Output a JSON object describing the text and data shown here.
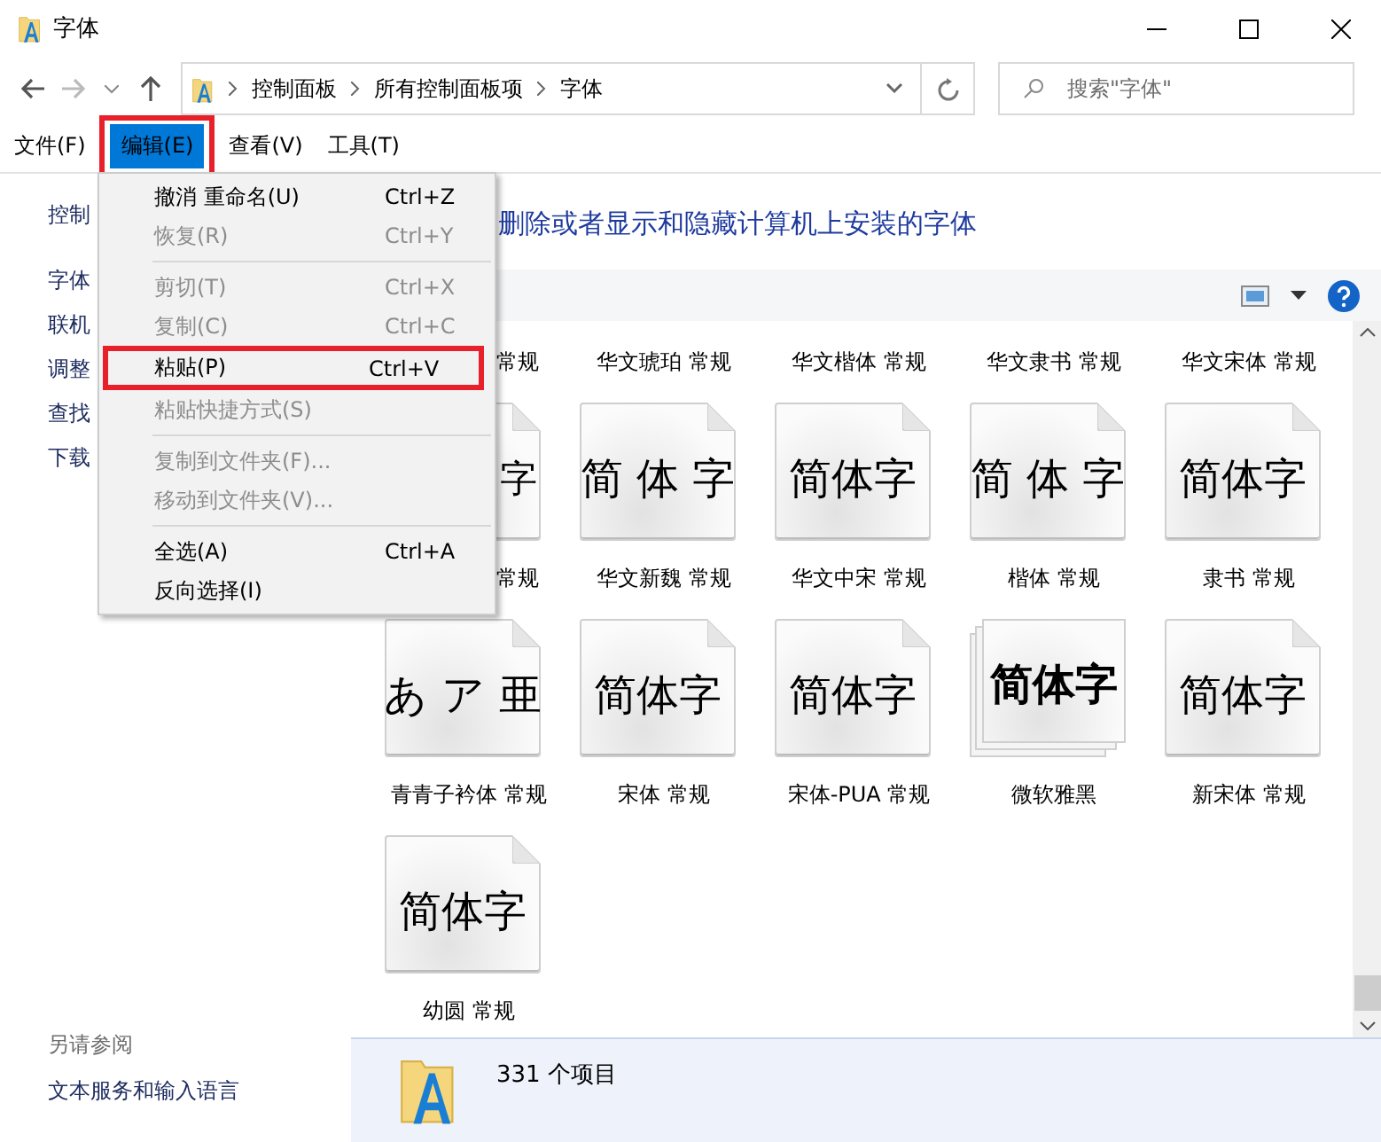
{
  "window": {
    "title": "字体"
  },
  "address_bar": {
    "crumbs": [
      "控制面板",
      "所有控制面板项",
      "字体"
    ]
  },
  "search": {
    "placeholder": "搜索\"字体\""
  },
  "menu_bar": [
    {
      "label": "文件(F)",
      "selected": false,
      "annotated": false
    },
    {
      "label": "编辑(E)",
      "selected": true,
      "annotated": true
    },
    {
      "label": "查看(V)",
      "selected": false,
      "annotated": false
    },
    {
      "label": "工具(T)",
      "selected": false,
      "annotated": false
    }
  ],
  "edit_menu": {
    "items": [
      {
        "kind": "item",
        "label": "撤消 重命名(U)",
        "shortcut": "Ctrl+Z",
        "disabled": false,
        "annotated": false
      },
      {
        "kind": "item",
        "label": "恢复(R)",
        "shortcut": "Ctrl+Y",
        "disabled": true,
        "annotated": false
      },
      {
        "kind": "separator"
      },
      {
        "kind": "item",
        "label": "剪切(T)",
        "shortcut": "Ctrl+X",
        "disabled": true,
        "annotated": false
      },
      {
        "kind": "item",
        "label": "复制(C)",
        "shortcut": "Ctrl+C",
        "disabled": true,
        "annotated": false
      },
      {
        "kind": "item",
        "label": "粘贴(P)",
        "shortcut": "Ctrl+V",
        "disabled": false,
        "annotated": true
      },
      {
        "kind": "item",
        "label": "粘贴快捷方式(S)",
        "disabled": true,
        "annotated": false
      },
      {
        "kind": "separator"
      },
      {
        "kind": "item",
        "label": "复制到文件夹(F)...",
        "disabled": true,
        "annotated": false
      },
      {
        "kind": "item",
        "label": "移动到文件夹(V)...",
        "disabled": true,
        "annotated": false
      },
      {
        "kind": "separator"
      },
      {
        "kind": "item",
        "label": "全选(A)",
        "shortcut": "Ctrl+A",
        "disabled": false,
        "annotated": false
      },
      {
        "kind": "item",
        "label": "反向选择(I)",
        "disabled": false,
        "annotated": false
      }
    ]
  },
  "sidebar": {
    "links": [
      "控制",
      "字体",
      "联机",
      "调整",
      "查找",
      "下载"
    ],
    "see_also_title": "另请参阅",
    "see_also": [
      "文本服务和输入语言"
    ]
  },
  "heading": "删除或者显示和隐藏计算机上安装的字体",
  "fonts": [
    {
      "kind": "clipped",
      "label": "常规"
    },
    {
      "kind": "full",
      "label": "华文琥珀 常规"
    },
    {
      "kind": "full",
      "label": "华文楷体 常规"
    },
    {
      "kind": "full",
      "label": "华文隶书 常规"
    },
    {
      "kind": "full",
      "label": "华文宋体 常规"
    },
    {
      "kind": "clipped",
      "label": "常规",
      "sample": "字",
      "stacked": false
    },
    {
      "kind": "full",
      "label": "华文新魏 常规",
      "sample": "简 体 字",
      "stacked": false
    },
    {
      "kind": "full",
      "label": "华文中宋 常规",
      "sample": "简体字",
      "stacked": false
    },
    {
      "kind": "full",
      "label": "楷体 常规",
      "sample": "简 体 字",
      "stacked": false
    },
    {
      "kind": "full",
      "label": "隶书 常规",
      "sample": "简体字",
      "stacked": false
    },
    {
      "kind": "full",
      "label": "青青子衿体 常规",
      "sample": "あ ア 亜",
      "stacked": false
    },
    {
      "kind": "full",
      "label": "宋体 常规",
      "sample": "简体字",
      "stacked": false
    },
    {
      "kind": "full",
      "label": "宋体-PUA 常规",
      "sample": "简体字",
      "stacked": false
    },
    {
      "kind": "full",
      "label": "微软雅黑",
      "sample": "简体字",
      "stacked": true
    },
    {
      "kind": "full",
      "label": "新宋体 常规",
      "sample": "简体字",
      "stacked": false
    },
    {
      "kind": "full",
      "label": "幼圆 常规",
      "sample": "简体字",
      "stacked": false
    }
  ],
  "status": {
    "count": "331 个项目"
  }
}
